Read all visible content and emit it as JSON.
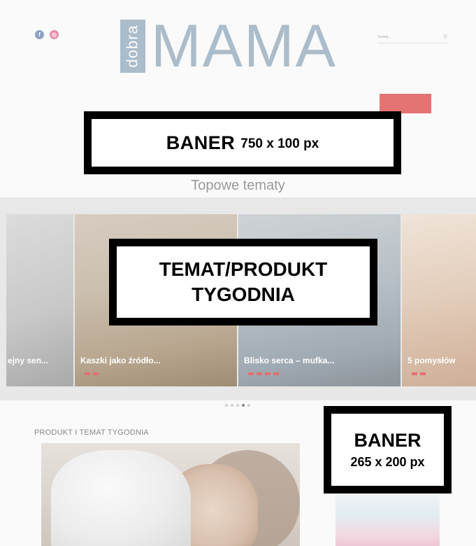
{
  "header": {
    "logo_small": "dobra",
    "logo_big": "MAMA",
    "search_placeholder": "Szukaj...",
    "social_icons": [
      "facebook-icon",
      "instagram-icon"
    ]
  },
  "ads": {
    "top": {
      "big": "BANER",
      "small": "750 x 100 px"
    },
    "middle": {
      "line1": "TEMAT/PRODUKT",
      "line2": "TYGODNIA"
    },
    "side": {
      "big": "BANER",
      "small": "265 x 200 px"
    }
  },
  "section_title": "Topowe tematy",
  "carousel": {
    "slides": [
      {
        "caption": "ejny sen..."
      },
      {
        "caption": "Kaszki jako źródło..."
      },
      {
        "caption": "Blisko serca – mufka..."
      },
      {
        "caption": "5 pomysłów"
      }
    ],
    "dot_count": 5,
    "active_dot": 3
  },
  "lower": {
    "title": "PRODUKT I TEMAT TYGODNIA"
  },
  "colors": {
    "logo": "#6b8aa4",
    "accent": "#e05a5a"
  }
}
